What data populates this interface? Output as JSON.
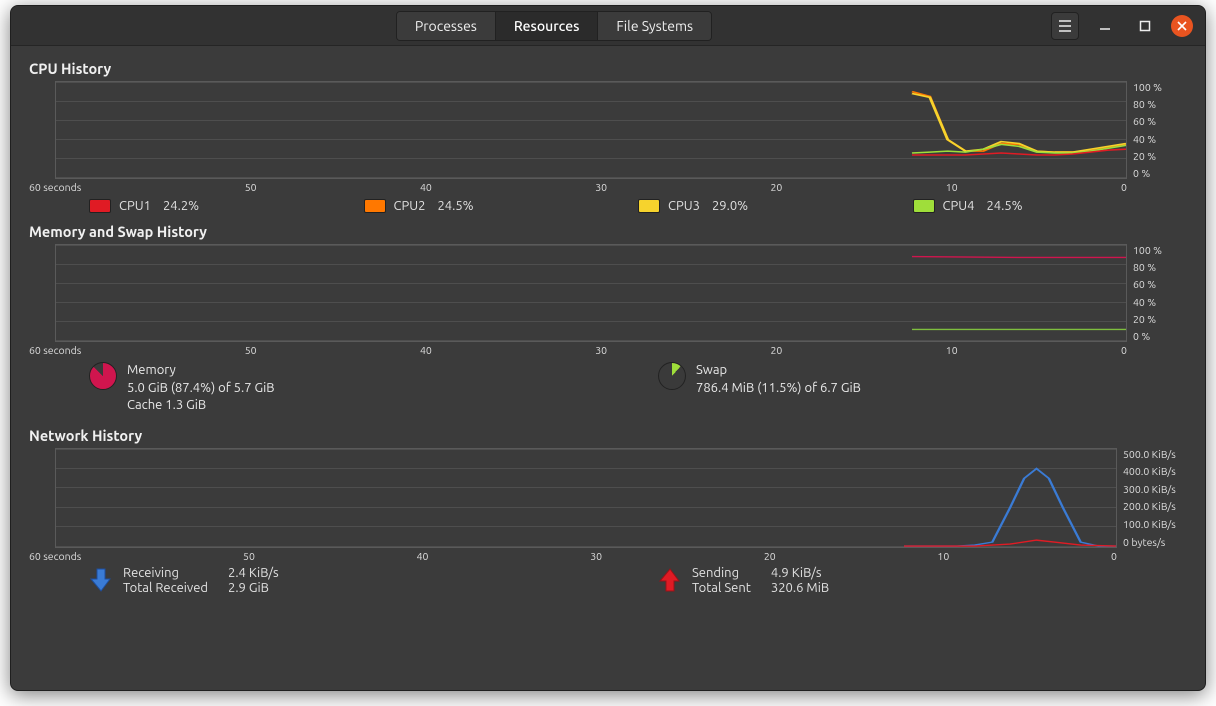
{
  "header": {
    "tabs": [
      "Processes",
      "Resources",
      "File Systems"
    ],
    "active_index": 1
  },
  "sections": {
    "cpu_title": "CPU History",
    "mem_title": "Memory and Swap History",
    "net_title": "Network History",
    "x_start": "60 seconds",
    "x_ticks": [
      "50",
      "40",
      "30",
      "20",
      "10",
      "0"
    ]
  },
  "cpu": {
    "ylabels": [
      "100 %",
      "80 %",
      "60 %",
      "40 %",
      "20 %",
      "0 %"
    ],
    "cores": [
      {
        "name": "CPU1",
        "pct": "24.2%",
        "color": "#e01b24"
      },
      {
        "name": "CPU2",
        "pct": "24.5%",
        "color": "#ff7800"
      },
      {
        "name": "CPU3",
        "pct": "29.0%",
        "color": "#f6d32d"
      },
      {
        "name": "CPU4",
        "pct": "24.5%",
        "color": "#9fde3a"
      }
    ]
  },
  "memory": {
    "ylabels": [
      "100 %",
      "80 %",
      "60 %",
      "40 %",
      "20 %",
      "0 %"
    ],
    "mem_label": "Memory",
    "mem_line1": "5.0 GiB (87.4%) of 5.7 GiB",
    "mem_line2": "Cache 1.3 GiB",
    "swap_label": "Swap",
    "swap_line1": "786.4 MiB (11.5%) of 6.7 GiB",
    "colors": {
      "mem": "#d0154e",
      "swap": "#7fbf3f"
    }
  },
  "network": {
    "ylabels": [
      "500.0 KiB/s",
      "400.0 KiB/s",
      "300.0 KiB/s",
      "200.0 KiB/s",
      "100.0 KiB/s",
      "0 bytes/s"
    ],
    "recv_label": "Receiving",
    "recv_rate": "2.4 KiB/s",
    "recv_total_label": "Total Received",
    "recv_total": "2.9 GiB",
    "send_label": "Sending",
    "send_rate": "4.9 KiB/s",
    "send_total_label": "Total Sent",
    "send_total": "320.6 MiB",
    "colors": {
      "recv": "#3a7bd5",
      "send": "#e01b24"
    }
  },
  "chart_data": [
    {
      "type": "line",
      "title": "CPU History",
      "xlabel": "seconds",
      "ylabel": "%",
      "xlim": [
        60,
        0
      ],
      "ylim": [
        0,
        100
      ],
      "x": [
        60,
        12,
        11,
        10,
        9,
        8,
        7,
        6,
        5,
        4,
        3,
        2,
        1,
        0
      ],
      "series": [
        {
          "name": "CPU1",
          "color": "#e01b24",
          "values": [
            null,
            24,
            24,
            24,
            24,
            25,
            26,
            25,
            24,
            24,
            25,
            27,
            29,
            30
          ]
        },
        {
          "name": "CPU2",
          "color": "#ff7800",
          "values": [
            null,
            90,
            85,
            40,
            28,
            28,
            36,
            35,
            28,
            27,
            27,
            29,
            32,
            35
          ]
        },
        {
          "name": "CPU3",
          "color": "#f6d32d",
          "values": [
            null,
            88,
            84,
            40,
            28,
            30,
            38,
            36,
            28,
            27,
            27,
            30,
            33,
            36
          ]
        },
        {
          "name": "CPU4",
          "color": "#9fde3a",
          "values": [
            null,
            26,
            27,
            28,
            27,
            30,
            35,
            33,
            27,
            26,
            26,
            28,
            31,
            34
          ]
        }
      ]
    },
    {
      "type": "line",
      "title": "Memory and Swap History",
      "xlabel": "seconds",
      "ylabel": "%",
      "xlim": [
        60,
        0
      ],
      "ylim": [
        0,
        100
      ],
      "x": [
        60,
        12,
        0
      ],
      "series": [
        {
          "name": "Memory",
          "color": "#d0154e",
          "values": [
            null,
            88,
            87
          ]
        },
        {
          "name": "Swap",
          "color": "#7fbf3f",
          "values": [
            null,
            12,
            12
          ]
        }
      ]
    },
    {
      "type": "line",
      "title": "Network History",
      "xlabel": "seconds",
      "ylabel": "KiB/s",
      "xlim": [
        60,
        0
      ],
      "ylim": [
        0,
        500
      ],
      "x": [
        60,
        12,
        10,
        8,
        7,
        6,
        5,
        4,
        3,
        2,
        1,
        0
      ],
      "series": [
        {
          "name": "Receiving",
          "color": "#3a7bd5",
          "values": [
            null,
            2,
            5,
            20,
            120,
            300,
            400,
            300,
            120,
            20,
            5,
            2
          ]
        },
        {
          "name": "Sending",
          "color": "#e01b24",
          "values": [
            null,
            4,
            8,
            15,
            25,
            35,
            30,
            22,
            15,
            10,
            6,
            5
          ]
        }
      ]
    }
  ]
}
